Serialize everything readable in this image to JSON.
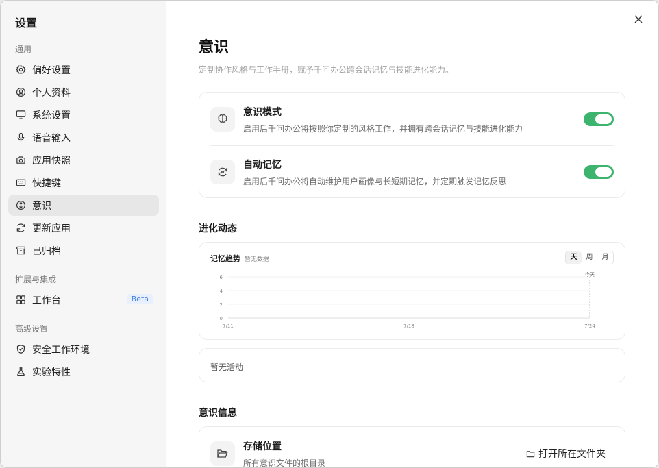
{
  "sidebar": {
    "title": "设置",
    "sections": {
      "general": "通用",
      "extensions": "扩展与集成",
      "advanced": "高级设置"
    },
    "items": [
      {
        "label": "偏好设置",
        "icon": "gear-icon"
      },
      {
        "label": "个人资料",
        "icon": "user-circle-icon"
      },
      {
        "label": "系统设置",
        "icon": "monitor-icon"
      },
      {
        "label": "语音输入",
        "icon": "microphone-icon"
      },
      {
        "label": "应用快照",
        "icon": "camera-icon"
      },
      {
        "label": "快捷键",
        "icon": "keyboard-icon"
      },
      {
        "label": "意识",
        "icon": "compass-icon",
        "active": true
      },
      {
        "label": "更新应用",
        "icon": "refresh-icon"
      },
      {
        "label": "已归档",
        "icon": "archive-icon"
      },
      {
        "label": "工作台",
        "icon": "grid-icon",
        "badge": "Beta"
      },
      {
        "label": "安全工作环境",
        "icon": "shield-icon"
      },
      {
        "label": "实验特性",
        "icon": "flask-icon"
      }
    ]
  },
  "main": {
    "title": "意识",
    "subtitle": "定制协作风格与工作手册，赋予千问办公跨会话记忆与技能进化能力。",
    "settings": [
      {
        "title": "意识模式",
        "desc": "启用后千问办公将按照你定制的风格工作，并拥有跨会话记忆与技能进化能力",
        "enabled": true,
        "icon": "brain-icon"
      },
      {
        "title": "自动记忆",
        "desc": "启用后千问办公将自动维护用户画像与长短期记忆，并定期触发记忆反思",
        "enabled": true,
        "icon": "sync-icon"
      }
    ],
    "evolution_title": "进化动态",
    "chart_card": {
      "title": "记忆趋势",
      "status": "暂无数据",
      "range_options": [
        "天",
        "周",
        "月"
      ],
      "range_selected": "天"
    },
    "activity_empty": "暂无活动",
    "info_title": "意识信息",
    "storage": {
      "title": "存储位置",
      "desc": "所有意识文件的根目录",
      "button": "打开所在文件夹"
    }
  },
  "chart_data": {
    "type": "line",
    "title": "记忆趋势",
    "x": [
      "7/11",
      "7/18",
      "7/24"
    ],
    "y_ticks": [
      0,
      2,
      4,
      6
    ],
    "ylim": [
      0,
      6
    ],
    "series": [],
    "annotations": [
      "今天"
    ],
    "grid": true
  },
  "colors": {
    "accent_toggle": "#3cb46e",
    "beta_text": "#3c7be0",
    "sidebar_bg": "#f6f6f6"
  }
}
